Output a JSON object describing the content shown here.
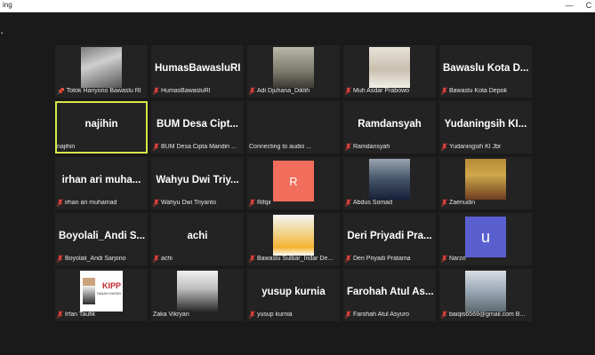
{
  "window": {
    "title": "ing",
    "close_label": "C",
    "min_label": "—"
  },
  "colors": {
    "active_outline": "#d7e64a",
    "mute": "#d9403a",
    "avatar_r": "#f16d5c",
    "avatar_u": "#5a5fd0"
  },
  "tiles": [
    {
      "id": "tiles.0",
      "kind": "video",
      "label": "Totok Hariyono Bawaslu RI",
      "pinned": true,
      "muted": false
    },
    {
      "id": "tiles.1",
      "kind": "name",
      "big": "HumasBawasluRI",
      "label": "HumasBawasluRI",
      "muted": true
    },
    {
      "id": "tiles.2",
      "kind": "video",
      "label": "Adi Djuhana_Diklih",
      "muted": true
    },
    {
      "id": "tiles.3",
      "kind": "video",
      "label": "Muh Asdar Prabowo",
      "muted": true
    },
    {
      "id": "tiles.4",
      "kind": "name",
      "big": "Bawaslu Kota D...",
      "label": "Bawaslu Kota Depok",
      "muted": true
    },
    {
      "id": "tiles.5",
      "kind": "name",
      "big": "najihin",
      "label": "najihin",
      "muted": false,
      "active": true
    },
    {
      "id": "tiles.6",
      "kind": "name",
      "big": "BUM Desa Cipt...",
      "label": "BUM Desa Cipta Mandiri ...",
      "muted": true
    },
    {
      "id": "tiles.7",
      "kind": "blank",
      "label": "Connecting to audio ...",
      "muted": false
    },
    {
      "id": "tiles.8",
      "kind": "name",
      "big": "Ramdansyah",
      "label": "Ramdansyah",
      "muted": true
    },
    {
      "id": "tiles.9",
      "kind": "name",
      "big": "Yudaningsih KI...",
      "label": "Yudaningsih KI Jbr",
      "muted": true
    },
    {
      "id": "tiles.10",
      "kind": "name",
      "big": "irhan ari muha...",
      "label": "irhan ari muhamad",
      "muted": true
    },
    {
      "id": "tiles.11",
      "kind": "name",
      "big": "Wahyu Dwi Triy...",
      "label": "Wahyu Dwi Triyanto",
      "muted": true
    },
    {
      "id": "tiles.12",
      "kind": "avatar",
      "avatar": "R",
      "label": "Rifqii",
      "muted": true
    },
    {
      "id": "tiles.13",
      "kind": "video",
      "label": "Abdus Somad",
      "muted": true
    },
    {
      "id": "tiles.14",
      "kind": "video",
      "label": "Zaenudin",
      "muted": true
    },
    {
      "id": "tiles.15",
      "kind": "name",
      "big": "Boyolali_Andi S...",
      "label": "Boyolali_Andi Sarjono",
      "muted": true
    },
    {
      "id": "tiles.16",
      "kind": "name",
      "big": "achi",
      "label": "achi",
      "muted": true
    },
    {
      "id": "tiles.17",
      "kind": "video",
      "label": "Bawaslu Sulbar_Indar De...",
      "muted": true
    },
    {
      "id": "tiles.18",
      "kind": "name",
      "big": "Deri Priyadi Pra...",
      "label": "Deri Priyadi Pratama",
      "muted": true
    },
    {
      "id": "tiles.19",
      "kind": "avatar",
      "avatar": "u",
      "label": "Narzo",
      "muted": true
    },
    {
      "id": "tiles.20",
      "kind": "video",
      "label": "Irfan Taufik",
      "muted": true,
      "kipp": {
        "title": "KIPP",
        "sub": "TANAH DATAR"
      }
    },
    {
      "id": "tiles.21",
      "kind": "video",
      "label": "Zaka Vikryan",
      "muted": false
    },
    {
      "id": "tiles.22",
      "kind": "name",
      "big": "yusup kurnia",
      "label": "yusup kurnia",
      "muted": true
    },
    {
      "id": "tiles.23",
      "kind": "name",
      "big": "Farohah Atul As...",
      "label": "Farohah Atul Asyuro",
      "muted": true
    },
    {
      "id": "tiles.24",
      "kind": "video",
      "label": "baiqis6569@gmail.com B...",
      "muted": true
    }
  ]
}
